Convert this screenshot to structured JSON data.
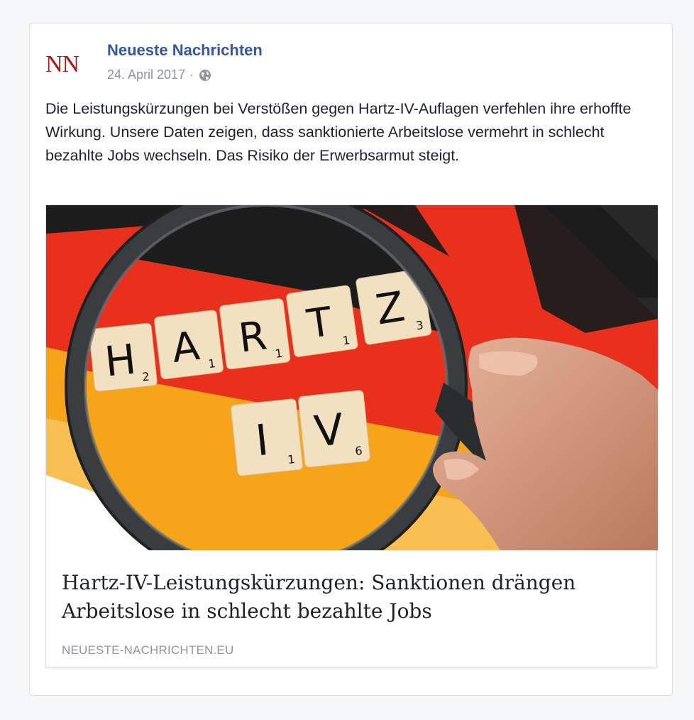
{
  "post": {
    "avatar_text": "NN",
    "page_name": "Neueste Nachrichten",
    "date": "24. April 2017",
    "separator": "·",
    "privacy_icon": "globe-icon",
    "text": "Die Leistungskürzungen bei Verstößen gegen Hartz-IV-Auflagen verfehlen ihre erhoffte Wirkung. Unsere Daten zeigen, dass sanktionierte Arbeitslose vermehrt in schlecht bezahlte Jobs wechseln. Das Risiko der Erwerbsarmut steigt."
  },
  "link": {
    "image": {
      "tiles_row1": [
        {
          "letter": "H",
          "score": "2"
        },
        {
          "letter": "A",
          "score": "1"
        },
        {
          "letter": "R",
          "score": "1"
        },
        {
          "letter": "T",
          "score": "1"
        },
        {
          "letter": "Z",
          "score": "3"
        }
      ],
      "tiles_row2": [
        {
          "letter": "I",
          "score": "1"
        },
        {
          "letter": "V",
          "score": "6"
        }
      ]
    },
    "headline": "Hartz-IV-Leistungskürzungen: Sanktionen drängen Arbeitslose in schlecht bezahlte Jobs",
    "domain": "NEUESTE-NACHRICHTEN.EU"
  },
  "colors": {
    "page_name": "#365899",
    "avatar": "#a61c1c",
    "meta": "#90949c",
    "flag_black": "#1c1c1c",
    "flag_red": "#e8301c",
    "flag_gold": "#f6a41a"
  }
}
